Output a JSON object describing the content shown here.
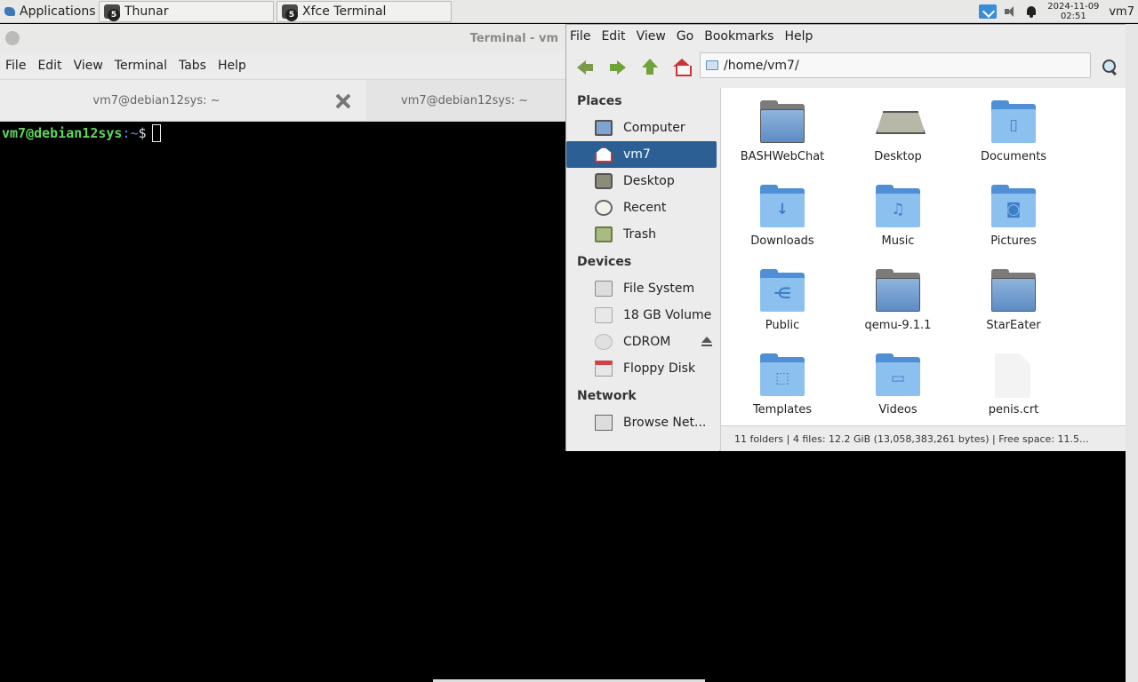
{
  "panel": {
    "applications_label": "Applications",
    "tasks": [
      {
        "label": "Thunar",
        "badge": "5"
      },
      {
        "label": "Xfce Terminal",
        "badge": "5"
      }
    ],
    "clock": {
      "date": "2024-11-09",
      "time": "02:51"
    },
    "user": "vm7"
  },
  "terminal": {
    "title": "Terminal - vm",
    "menu": [
      "File",
      "Edit",
      "View",
      "Terminal",
      "Tabs",
      "Help"
    ],
    "tabs": [
      "vm7@debian12sys: ~",
      "vm7@debian12sys: ~"
    ],
    "prompt_user": "vm7@debian12sys",
    "prompt_path": ":~",
    "prompt_symbol": "$"
  },
  "filemanager": {
    "menu": [
      "File",
      "Edit",
      "View",
      "Go",
      "Bookmarks",
      "Help"
    ],
    "location": "/home/vm7/",
    "places_header": "Places",
    "places": [
      "Computer",
      "vm7",
      "Desktop",
      "Recent",
      "Trash"
    ],
    "devices_header": "Devices",
    "devices": [
      "File System",
      "18 GB Volume",
      "CDROM",
      "Floppy Disk"
    ],
    "network_header": "Network",
    "network": [
      "Browse Net..."
    ],
    "items": [
      "BASHWebChat",
      "Desktop",
      "Documents",
      "Downloads",
      "Music",
      "Pictures",
      "Public",
      "qemu-9.1.1",
      "StarEater",
      "Templates",
      "Videos",
      "penis.crt"
    ],
    "status": "11 folders  |  4 files: 12.2 GiB (13,058,383,261 bytes)  |  Free space: 11.5..."
  }
}
